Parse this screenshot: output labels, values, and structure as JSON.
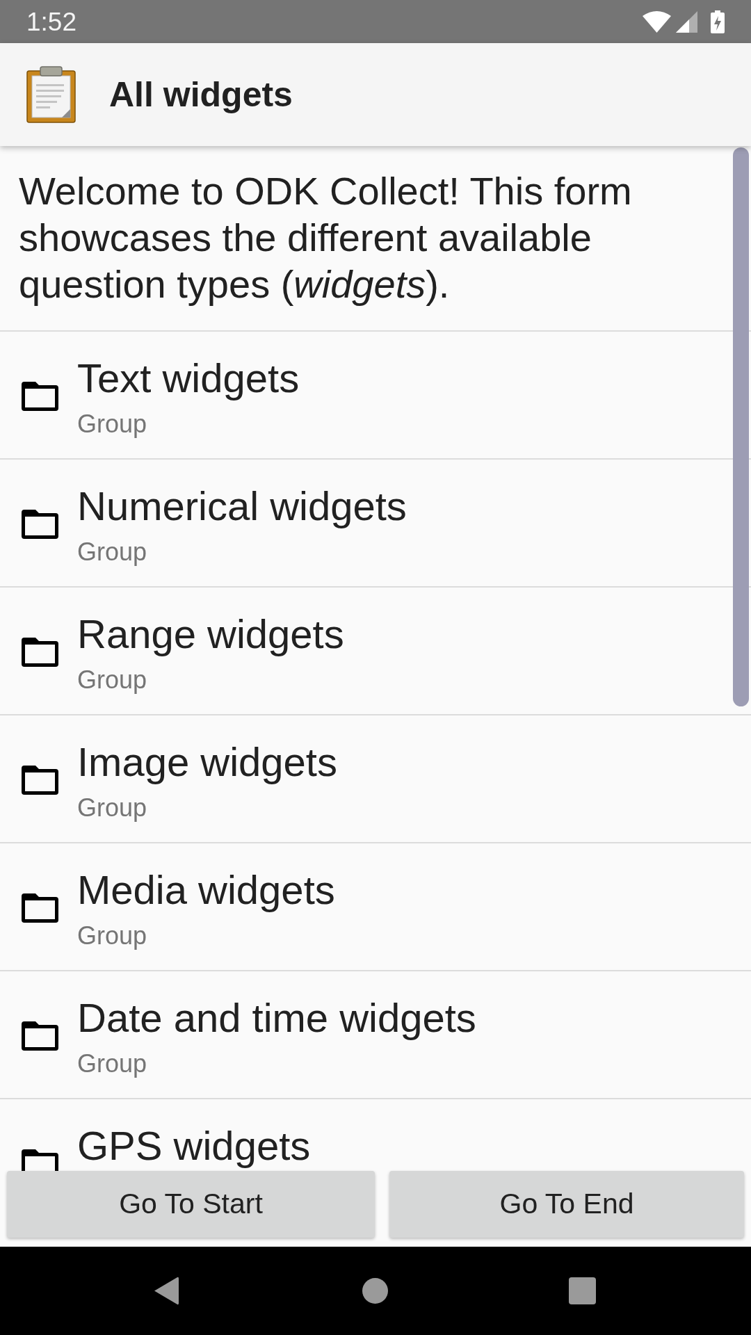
{
  "status_bar": {
    "time": "1:52"
  },
  "app_bar": {
    "title": "All widgets"
  },
  "intro": {
    "text": "Welcome to ODK Collect! This form showcases the different available question types (*widgets*)."
  },
  "items": [
    {
      "title": "Text widgets",
      "subtitle": "Group"
    },
    {
      "title": "Numerical widgets",
      "subtitle": "Group"
    },
    {
      "title": "Range widgets",
      "subtitle": "Group"
    },
    {
      "title": "Image widgets",
      "subtitle": "Group"
    },
    {
      "title": "Media widgets",
      "subtitle": "Group"
    },
    {
      "title": "Date and time widgets",
      "subtitle": "Group"
    },
    {
      "title": "GPS widgets"
    }
  ],
  "buttons": [
    {
      "label": "Go To Start"
    },
    {
      "label": "Go To End"
    }
  ]
}
